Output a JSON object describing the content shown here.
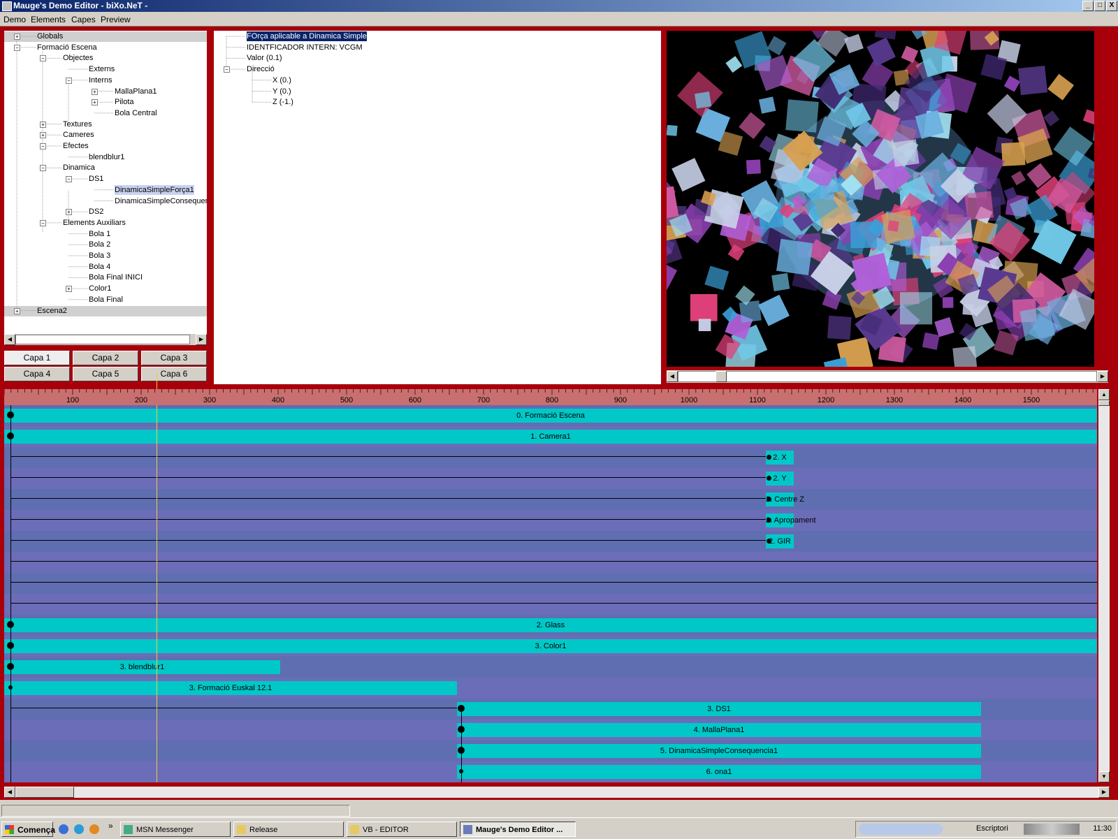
{
  "window": {
    "title": "Mauge's Demo Editor - biXo.NeT -",
    "controls": {
      "minimize": "_",
      "maximize": "□",
      "close": "X"
    }
  },
  "menu": [
    "Demo",
    "Elements",
    "Capes",
    "Preview"
  ],
  "tree": {
    "items": [
      {
        "label": "Globals",
        "depth": 0,
        "expander": "+",
        "selected": false
      },
      {
        "label": "Formació Escena",
        "depth": 0,
        "expander": "-",
        "selected": false
      },
      {
        "label": "Objectes",
        "depth": 1,
        "expander": "-",
        "selected": false
      },
      {
        "label": "Externs",
        "depth": 2,
        "expander": "",
        "selected": false
      },
      {
        "label": "Interns",
        "depth": 2,
        "expander": "-",
        "selected": false
      },
      {
        "label": "MallaPlana1",
        "depth": 3,
        "expander": "+",
        "selected": false
      },
      {
        "label": "Pilota",
        "depth": 3,
        "expander": "+",
        "selected": false
      },
      {
        "label": "Bola Central",
        "depth": 3,
        "expander": "",
        "selected": false
      },
      {
        "label": "Textures",
        "depth": 1,
        "expander": "+",
        "selected": false
      },
      {
        "label": "Cameres",
        "depth": 1,
        "expander": "+",
        "selected": false
      },
      {
        "label": "Efectes",
        "depth": 1,
        "expander": "-",
        "selected": false
      },
      {
        "label": "blendblur1",
        "depth": 2,
        "expander": "",
        "selected": false
      },
      {
        "label": "Dinamica",
        "depth": 1,
        "expander": "-",
        "selected": false
      },
      {
        "label": "DS1",
        "depth": 2,
        "expander": "-",
        "selected": false
      },
      {
        "label": "DinamicaSimpleForça1",
        "depth": 3,
        "expander": "",
        "selected": true
      },
      {
        "label": "DinamicaSimpleConsequenc",
        "depth": 3,
        "expander": "",
        "selected": false
      },
      {
        "label": "DS2",
        "depth": 2,
        "expander": "+",
        "selected": false
      },
      {
        "label": "Elements Auxiliars",
        "depth": 1,
        "expander": "-",
        "selected": false
      },
      {
        "label": "Bola 1",
        "depth": 2,
        "expander": "",
        "selected": false
      },
      {
        "label": "Bola 2",
        "depth": 2,
        "expander": "",
        "selected": false
      },
      {
        "label": "Bola 3",
        "depth": 2,
        "expander": "",
        "selected": false
      },
      {
        "label": "Bola 4",
        "depth": 2,
        "expander": "",
        "selected": false
      },
      {
        "label": "Bola Final INICI",
        "depth": 2,
        "expander": "",
        "selected": false
      },
      {
        "label": "Color1",
        "depth": 2,
        "expander": "+",
        "selected": false
      },
      {
        "label": "Bola Final",
        "depth": 2,
        "expander": "",
        "selected": false
      },
      {
        "label": "Escena2",
        "depth": 0,
        "expander": "+",
        "selected": false
      }
    ]
  },
  "capes": [
    "Capa 1",
    "Capa 2",
    "Capa 3",
    "Capa 4",
    "Capa 5",
    "Capa 6"
  ],
  "properties": {
    "items": [
      {
        "label": "FOrça aplicable a Dinamica Simple",
        "depth": 0,
        "expander": "",
        "selected": true
      },
      {
        "label": "IDENTFICADOR INTERN: VCGM",
        "depth": 0,
        "expander": "",
        "selected": false
      },
      {
        "label": "Valor (0.1)",
        "depth": 0,
        "expander": "",
        "selected": false
      },
      {
        "label": "Direcció",
        "depth": 0,
        "expander": "-",
        "selected": false
      },
      {
        "label": "X (0.)",
        "depth": 1,
        "expander": "",
        "selected": false
      },
      {
        "label": "Y (0.)",
        "depth": 1,
        "expander": "",
        "selected": false
      },
      {
        "label": "Z (-1.)",
        "depth": 1,
        "expander": "",
        "selected": false
      }
    ]
  },
  "timeline": {
    "ruler_ticks": [
      "100",
      "200",
      "300",
      "400",
      "500",
      "600",
      "700",
      "800",
      "900",
      "1000",
      "1100",
      "1200",
      "1300",
      "1400",
      "1500"
    ],
    "cursor_time": 222,
    "tracks": [
      {
        "label": "0. Formació Escena",
        "start": 0,
        "end": 1564,
        "dot": "big"
      },
      {
        "label": "1. Camera1",
        "start": 0,
        "end": 1564,
        "dot": "big"
      },
      {
        "label": "2. X",
        "start": 1090,
        "end": 1130,
        "dot": "line"
      },
      {
        "label": "2. Y",
        "start": 1090,
        "end": 1130,
        "dot": "line"
      },
      {
        "label": "2. Centre Z",
        "start": 1090,
        "end": 1130,
        "dot": "line"
      },
      {
        "label": "2. Apropament",
        "start": 1090,
        "end": 1130,
        "dot": "line"
      },
      {
        "label": "2. GIR",
        "start": 1090,
        "end": 1130,
        "dot": "line"
      },
      {
        "label": "",
        "start": 0,
        "end": 0,
        "dot": "lineonly"
      },
      {
        "label": "",
        "start": 0,
        "end": 0,
        "dot": "lineonly"
      },
      {
        "label": "",
        "start": 0,
        "end": 0,
        "dot": "lineonly"
      },
      {
        "label": "2. Glass",
        "start": 0,
        "end": 1564,
        "dot": "big"
      },
      {
        "label": "3. Color1",
        "start": 0,
        "end": 1564,
        "dot": "big"
      },
      {
        "label": "3. blendblur1",
        "start": 0,
        "end": 395,
        "dot": "big"
      },
      {
        "label": "3. Formació Euskal 12.1",
        "start": 0,
        "end": 648,
        "dot": "small"
      },
      {
        "label": "3. DS1",
        "start": 648,
        "end": 1398,
        "dot": "big-line"
      },
      {
        "label": "4. MallaPlana1",
        "start": 648,
        "end": 1398,
        "dot": "big"
      },
      {
        "label": "5. DinamicaSimpleConsequencia1",
        "start": 648,
        "end": 1398,
        "dot": "big"
      },
      {
        "label": "6. ona1",
        "start": 648,
        "end": 1398,
        "dot": "small"
      }
    ]
  },
  "taskbar": {
    "start": "Comença",
    "tasks": [
      {
        "label": "MSN Messenger",
        "active": false
      },
      {
        "label": "Release",
        "active": false
      },
      {
        "label": "VB - EDITOR",
        "active": false
      },
      {
        "label": "Mauge's Demo Editor ...",
        "active": true
      }
    ],
    "tray_label": "Escriptori",
    "clock": "11:30"
  }
}
